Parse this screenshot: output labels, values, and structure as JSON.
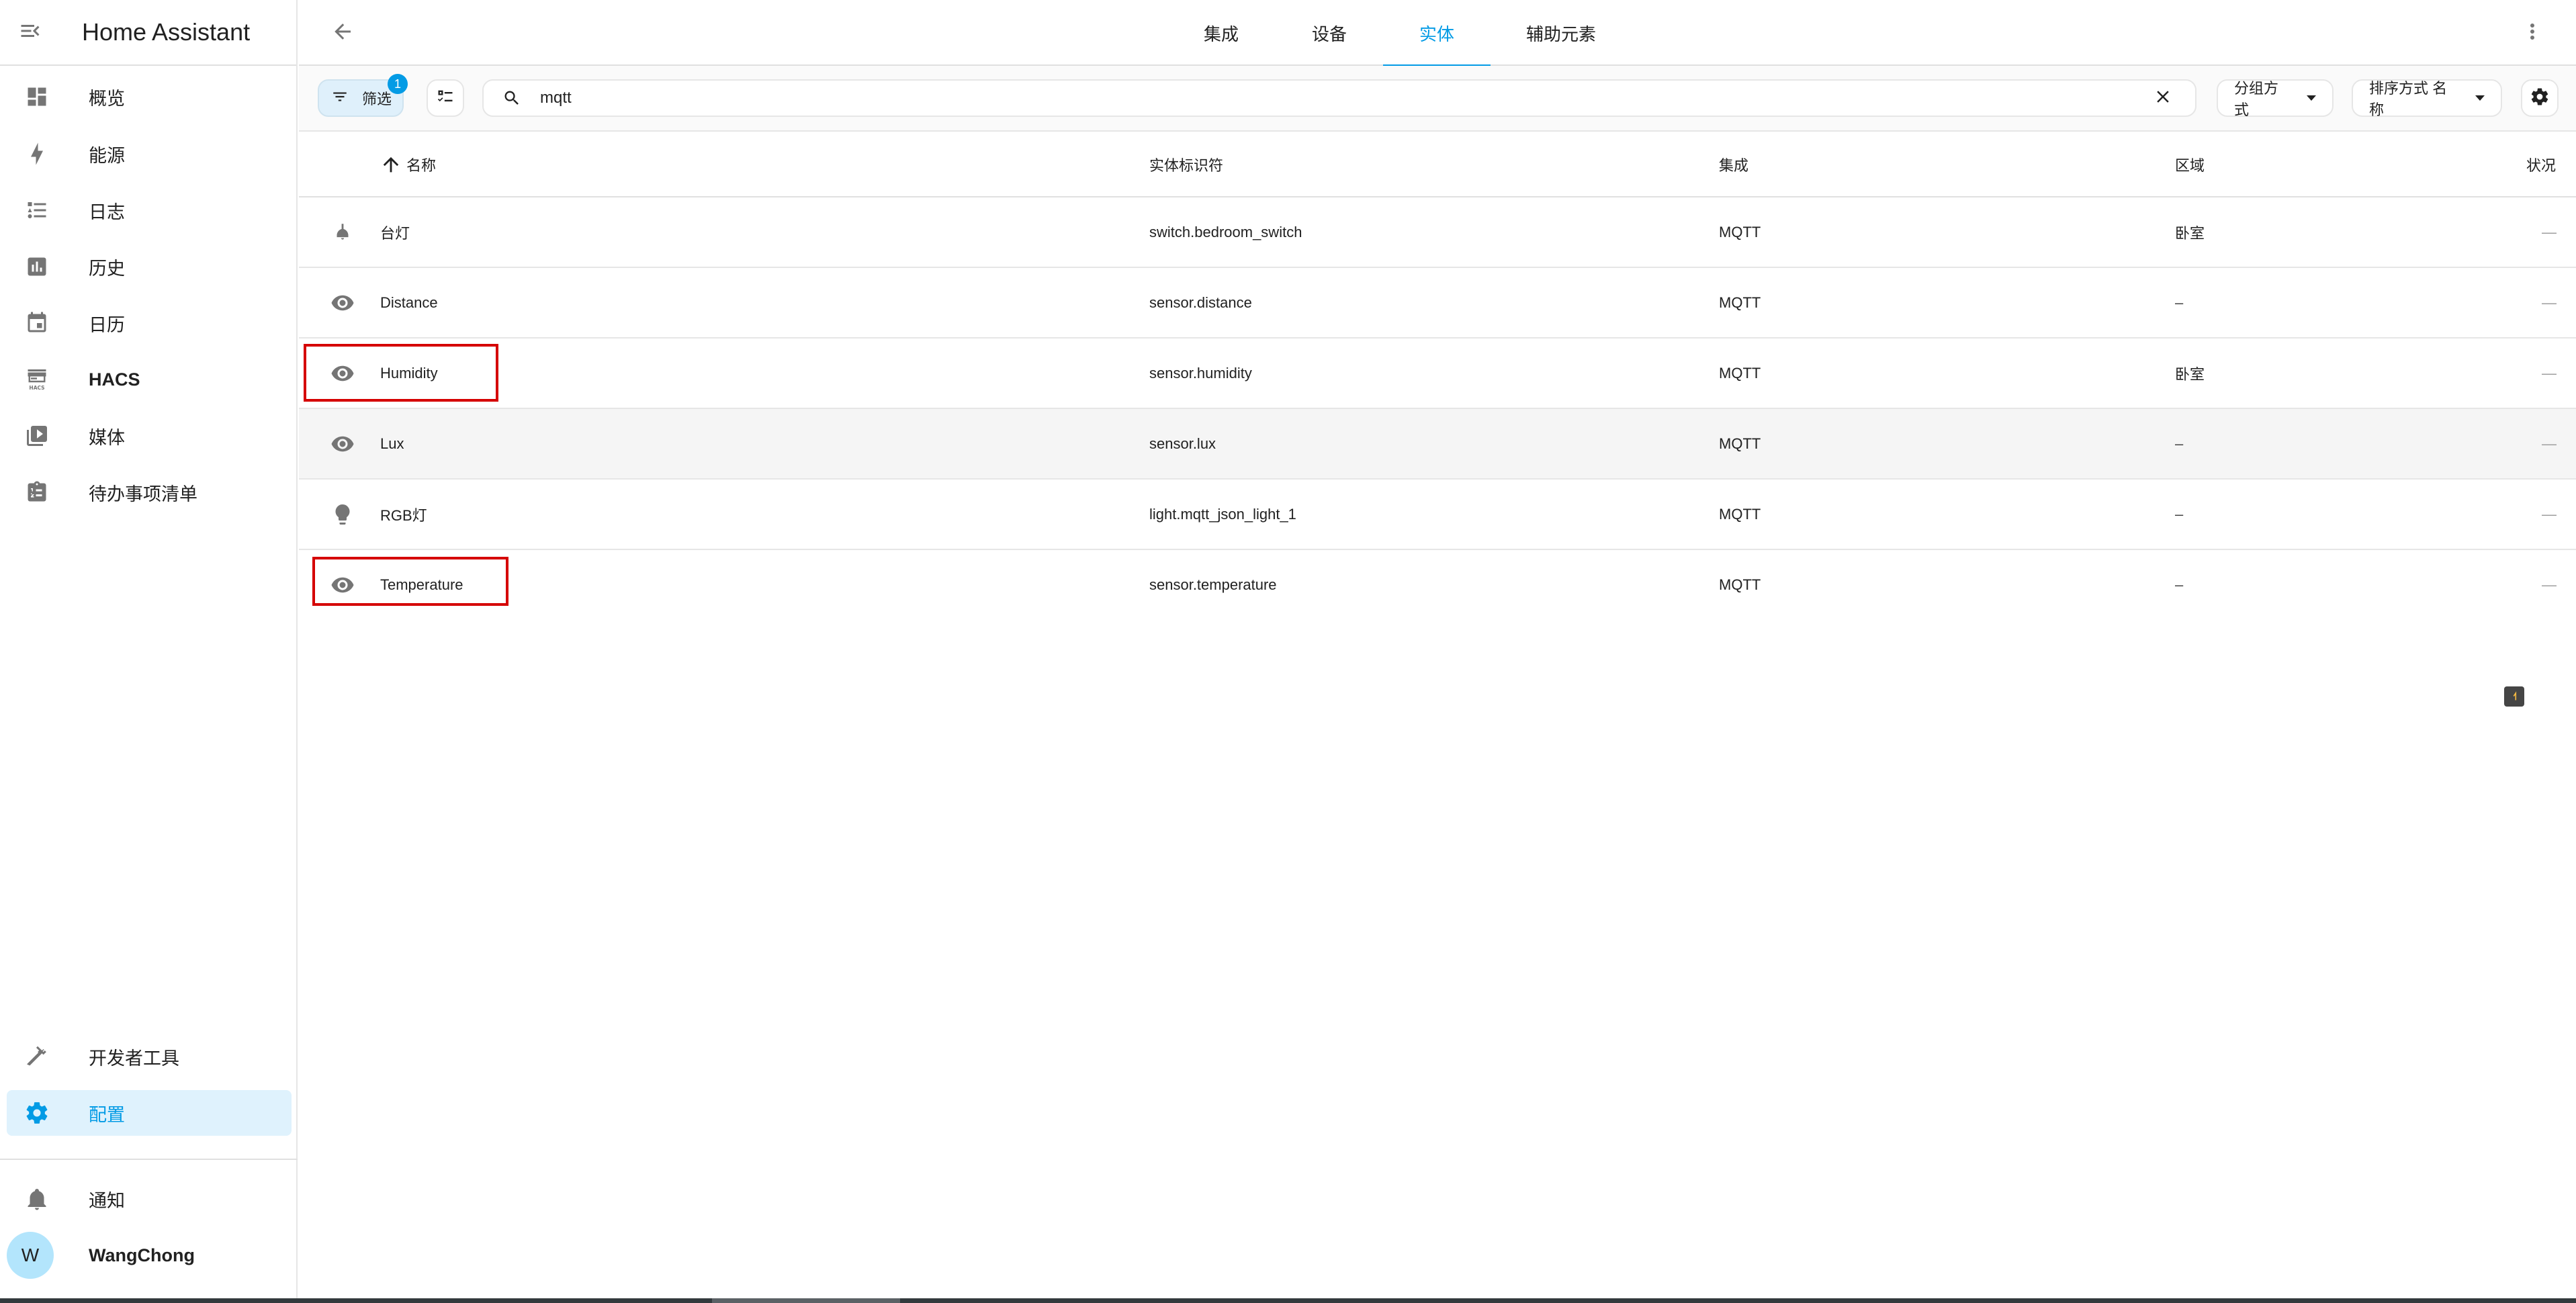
{
  "app": {
    "title": "Home Assistant"
  },
  "sidebar": {
    "items": [
      {
        "label": "概览",
        "icon": "dashboard-icon"
      },
      {
        "label": "能源",
        "icon": "lightning-bolt-icon"
      },
      {
        "label": "日志",
        "icon": "format-list-bulleted-icon"
      },
      {
        "label": "历史",
        "icon": "chart-box-icon"
      },
      {
        "label": "日历",
        "icon": "calendar-icon"
      },
      {
        "label": "HACS",
        "icon": "hacs-store-icon"
      },
      {
        "label": "媒体",
        "icon": "play-box-multiple-icon"
      },
      {
        "label": "待办事项清单",
        "icon": "clipboard-list-icon"
      }
    ],
    "bottom_items": [
      {
        "label": "开发者工具",
        "icon": "hammer-icon"
      },
      {
        "label": "配置",
        "icon": "cog-icon",
        "active": true
      }
    ],
    "notifications_label": "通知",
    "user": {
      "name": "WangChong",
      "initial": "W"
    }
  },
  "header": {
    "tabs": [
      {
        "label": "集成",
        "active": false
      },
      {
        "label": "设备",
        "active": false
      },
      {
        "label": "实体",
        "active": true
      },
      {
        "label": "辅助元素",
        "active": false
      }
    ]
  },
  "toolbar": {
    "filter_label": "筛选",
    "filter_count": "1",
    "search_value": "mqtt",
    "group_by_label": "分组方式",
    "sort_label": "排序方式 名称"
  },
  "table": {
    "columns": {
      "name": "名称",
      "entity_id": "实体标识符",
      "integration": "集成",
      "area": "区域",
      "status": "状况"
    },
    "rows": [
      {
        "icon": "ceiling-light-icon",
        "name": "台灯",
        "entity_id": "switch.bedroom_switch",
        "integration": "MQTT",
        "area": "卧室",
        "status": "—",
        "highlighted": false
      },
      {
        "icon": "eye-icon",
        "name": "Distance",
        "entity_id": "sensor.distance",
        "integration": "MQTT",
        "area": "–",
        "status": "—",
        "highlighted": false
      },
      {
        "icon": "eye-icon",
        "name": "Humidity",
        "entity_id": "sensor.humidity",
        "integration": "MQTT",
        "area": "卧室",
        "status": "—",
        "highlighted": true
      },
      {
        "icon": "eye-icon",
        "name": "Lux",
        "entity_id": "sensor.lux",
        "integration": "MQTT",
        "area": "–",
        "status": "—",
        "highlighted": false,
        "hover": true
      },
      {
        "icon": "lightbulb-icon",
        "name": "RGB灯",
        "entity_id": "light.mqtt_json_light_1",
        "integration": "MQTT",
        "area": "–",
        "status": "—",
        "highlighted": false
      },
      {
        "icon": "eye-icon",
        "name": "Temperature",
        "entity_id": "sensor.temperature",
        "integration": "MQTT",
        "area": "–",
        "status": "—",
        "highlighted": true
      }
    ]
  },
  "colors": {
    "accent": "#039be5",
    "active_bg": "#dff2fd",
    "highlight_box": "#d50000",
    "icon_grey": "#757575"
  }
}
